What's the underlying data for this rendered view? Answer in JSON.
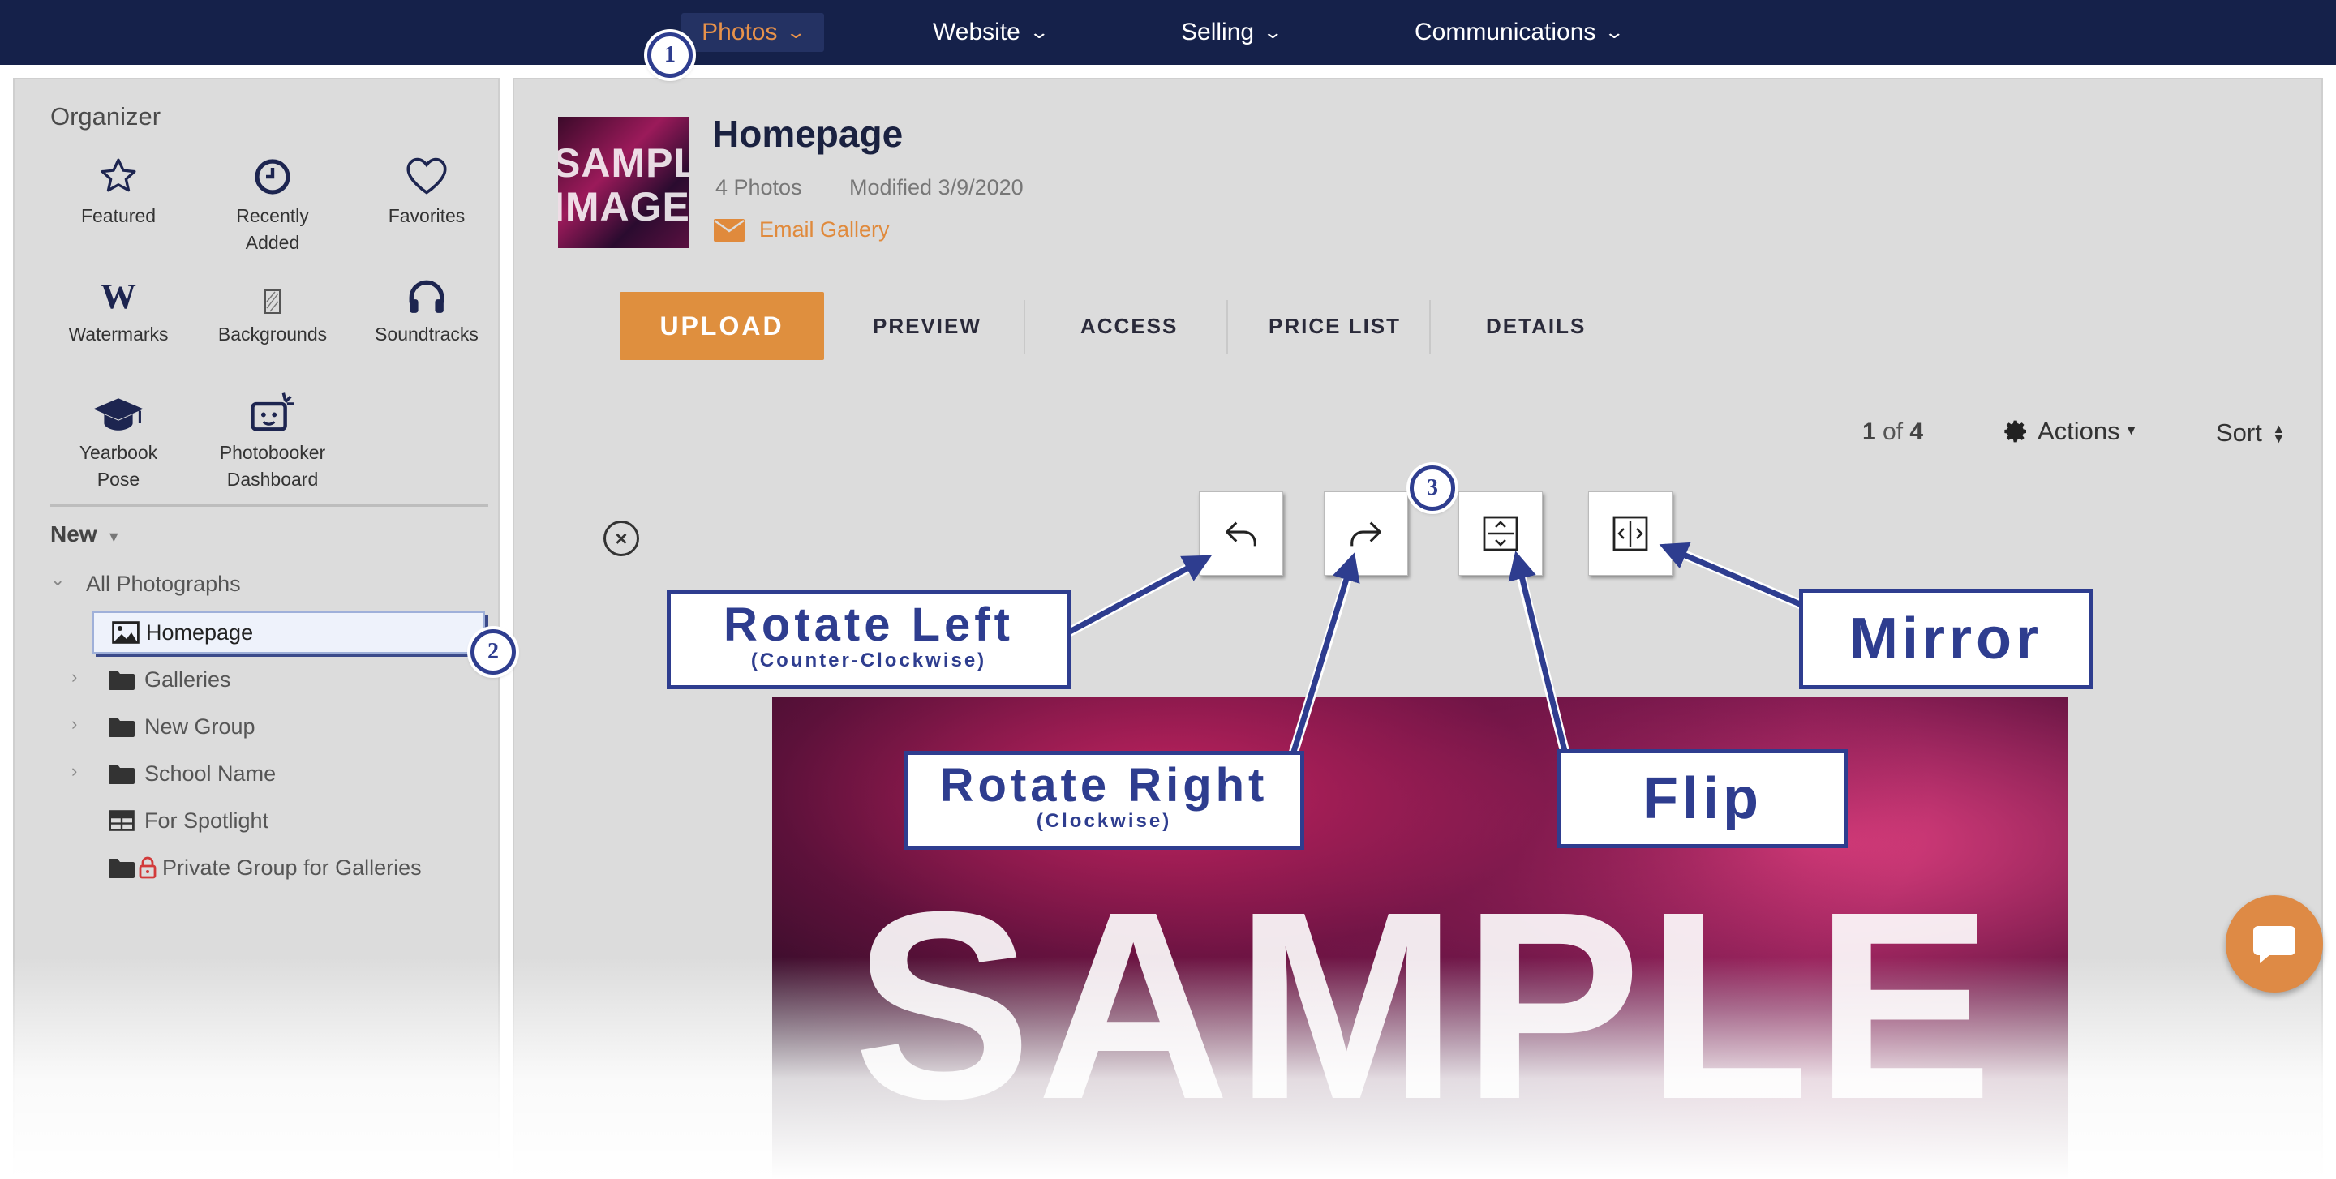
{
  "topnav": {
    "items": [
      {
        "label": "Photos",
        "active": true
      },
      {
        "label": "Website"
      },
      {
        "label": "Selling"
      },
      {
        "label": "Communications"
      }
    ]
  },
  "organizer": {
    "title": "Organizer",
    "items": [
      {
        "label": "Featured",
        "icon": "star-icon"
      },
      {
        "label": "Recently Added",
        "icon": "clock-icon"
      },
      {
        "label": "Favorites",
        "icon": "heart-icon"
      },
      {
        "label": "Watermarks",
        "icon": "watermark-w-icon"
      },
      {
        "label": "Backgrounds",
        "icon": "backgrounds-icon"
      },
      {
        "label": "Soundtracks",
        "icon": "headphones-icon"
      },
      {
        "label": "Yearbook Pose",
        "icon": "graduation-cap-icon"
      },
      {
        "label": "Photobooker Dashboard",
        "icon": "photobooker-icon"
      }
    ],
    "new_label": "New",
    "tree": {
      "root": "All Photographs",
      "items": [
        {
          "label": "Homepage",
          "icon": "image-icon",
          "selected": true
        },
        {
          "label": "Galleries",
          "icon": "folder-icon"
        },
        {
          "label": "New Group",
          "icon": "folder-icon"
        },
        {
          "label": "School Name",
          "icon": "folder-icon"
        },
        {
          "label": "For Spotlight",
          "icon": "table-icon"
        },
        {
          "label": "Private Group for Galleries",
          "icon": "folder-lock-icon"
        }
      ]
    }
  },
  "gallery": {
    "thumb_text_1": "SAMPL",
    "thumb_text_2": "IMAGE",
    "title": "Homepage",
    "photo_count": "4 Photos",
    "modified": "Modified 3/9/2020",
    "email_label": "Email Gallery"
  },
  "tabs": {
    "upload": "UPLOAD",
    "items": [
      "PREVIEW",
      "ACCESS",
      "PRICE LIST",
      "DETAILS"
    ]
  },
  "pager": {
    "current": "1",
    "of": "of",
    "total": "4"
  },
  "toolbar": {
    "actions_label": "Actions",
    "sort_label": "Sort"
  },
  "photo": {
    "text": "SAMPLE"
  },
  "annotations": {
    "badges": [
      "1",
      "2",
      "3"
    ],
    "rotate_left": {
      "title": "Rotate Left",
      "sub": "(Counter-Clockwise)"
    },
    "rotate_right": {
      "title": "Rotate Right",
      "sub": "(Clockwise)"
    },
    "flip": {
      "title": "Flip"
    },
    "mirror": {
      "title": "Mirror"
    }
  },
  "colors": {
    "nav_bg": "#15214a",
    "accent_orange": "#df8f3e",
    "annotation_blue": "#2e3d8f"
  }
}
